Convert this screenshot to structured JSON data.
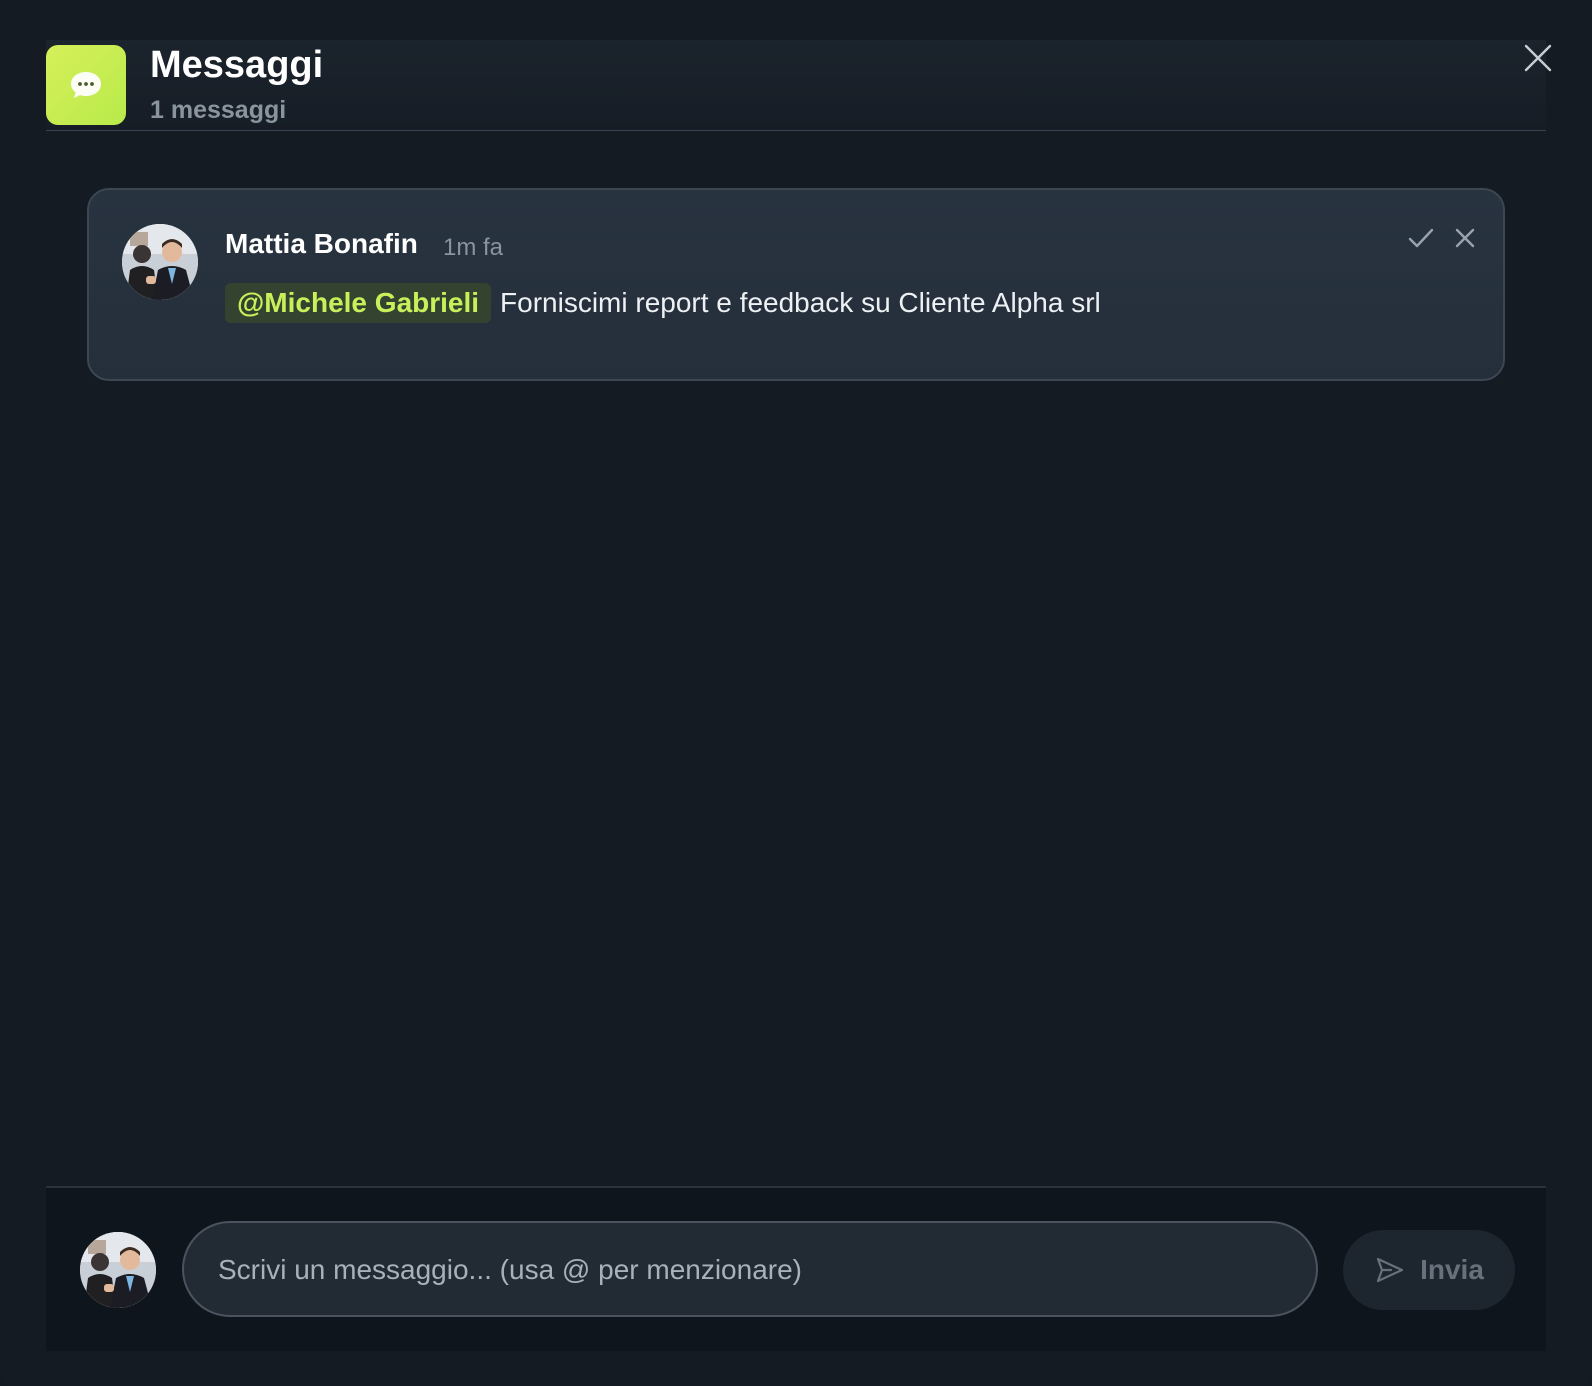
{
  "header": {
    "title": "Messaggi",
    "subtitle": "1 messaggi",
    "icon": "chat-bubble-icon",
    "accent": "#c8f05a"
  },
  "messages": [
    {
      "sender": "Mattia Bonafin",
      "time": "1m fa",
      "mention": "@Michele Gabrieli",
      "text": "Forniscimi report e feedback su Cliente Alpha srl"
    }
  ],
  "composer": {
    "placeholder": "Scrivi un messaggio... (usa @ per menzionare)",
    "value": "",
    "send_label": "Invia"
  }
}
